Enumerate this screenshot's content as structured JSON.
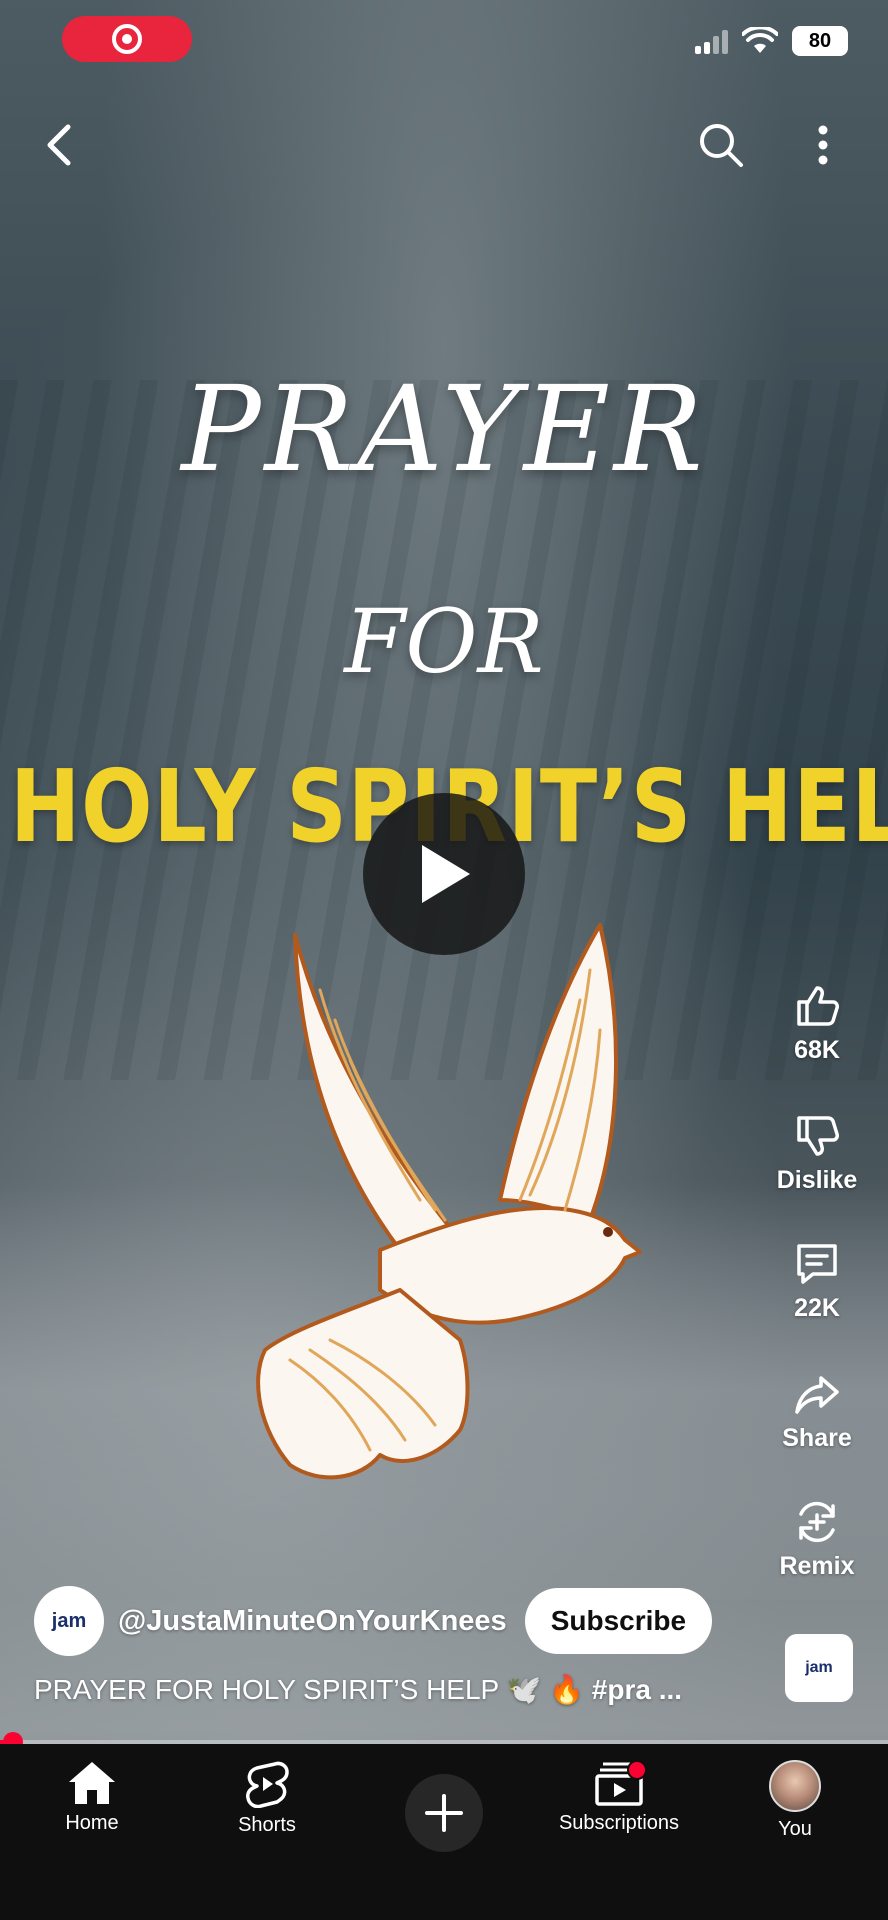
{
  "status_bar": {
    "battery": "80"
  },
  "video": {
    "title_line1": "PRAYER",
    "title_line2": "FOR",
    "title_line3": "HOLY SPIRIT’S HELP",
    "progress": 0.01
  },
  "actions": {
    "like": "68K",
    "dislike": "Dislike",
    "comments": "22K",
    "share": "Share",
    "remix": "Remix"
  },
  "channel": {
    "avatar_text": "jam",
    "handle": "@JustaMinuteOnYourKnees",
    "subscribe_label": "Subscribe"
  },
  "caption": {
    "text": "PRAYER FOR HOLY SPIRIT’S HELP 🕊️ 🔥 ",
    "tag": "#pra ..."
  },
  "sound": {
    "thumb_text": "jam"
  },
  "nav": {
    "home": "Home",
    "shorts": "Shorts",
    "subscriptions": "Subscriptions",
    "you": "You"
  },
  "colors": {
    "accent": "#ff0033",
    "title_yellow": "#f0d22a",
    "rec": "#e8253c"
  },
  "icons": [
    "back-icon",
    "search-icon",
    "more-vert-icon",
    "play-icon",
    "thumb-up-icon",
    "thumb-down-icon",
    "comment-icon",
    "share-icon",
    "remix-icon",
    "home-icon",
    "shorts-icon",
    "plus-icon",
    "subscriptions-icon"
  ]
}
